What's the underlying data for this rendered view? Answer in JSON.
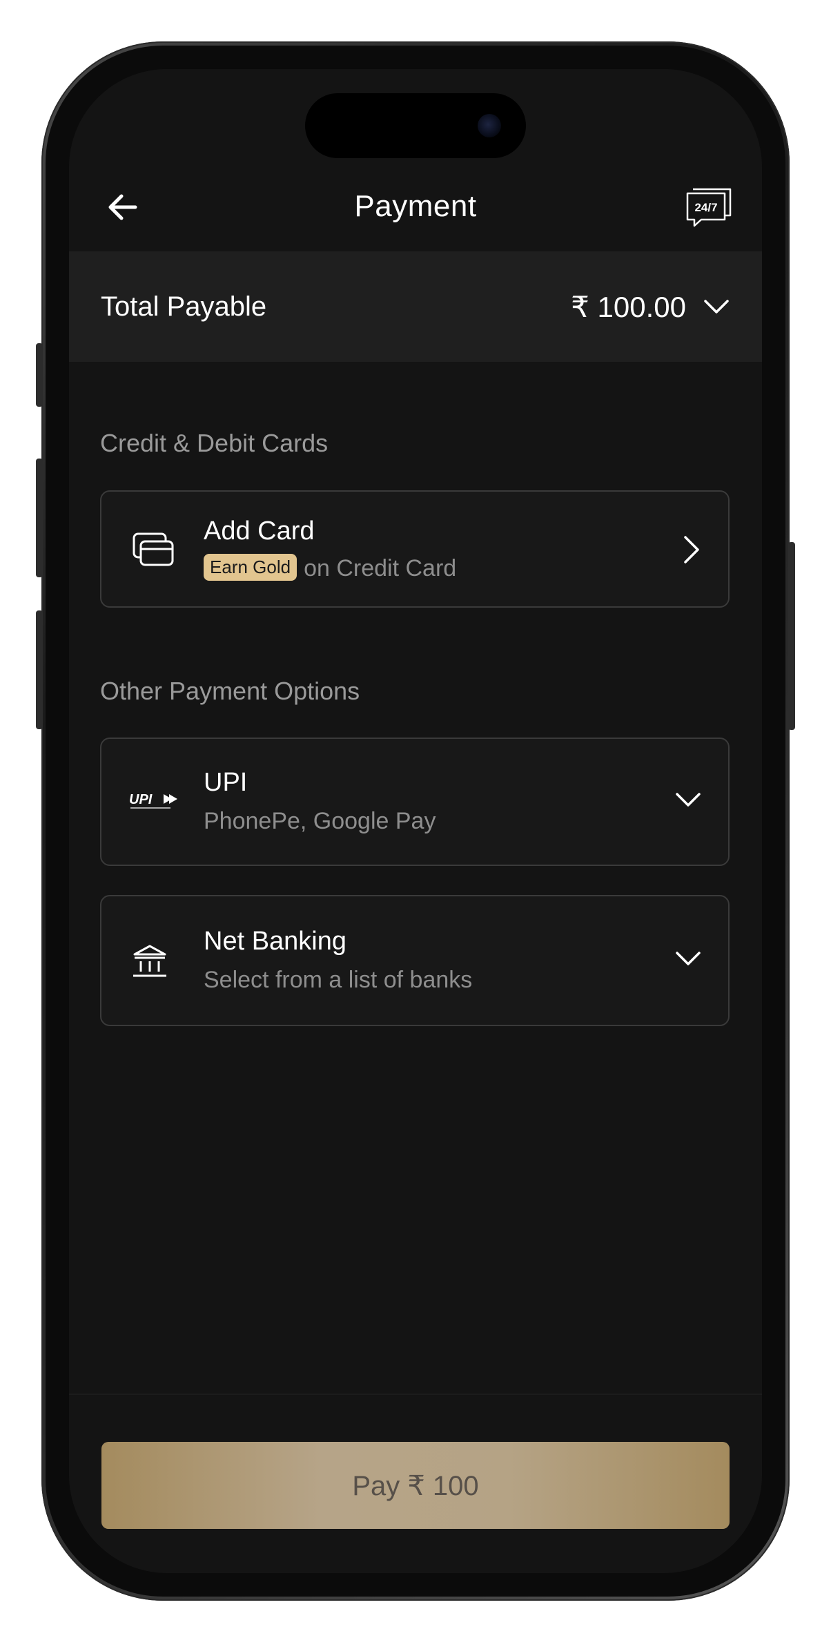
{
  "header": {
    "title": "Payment",
    "support_icon_text": "24/7"
  },
  "total": {
    "label": "Total Payable",
    "amount": "₹ 100.00"
  },
  "cards_section": {
    "title": "Credit & Debit Cards",
    "add_card": {
      "title": "Add Card",
      "badge": "Earn Gold",
      "subtitle": "on Credit Card"
    }
  },
  "other_section": {
    "title": "Other Payment Options",
    "upi": {
      "title": "UPI",
      "subtitle": "PhonePe, Google Pay"
    },
    "net_banking": {
      "title": "Net Banking",
      "subtitle": "Select from a list of banks"
    }
  },
  "pay_button": {
    "label": "Pay ₹ 100"
  },
  "icons": {
    "back": "arrow-left-icon",
    "support": "support-24-7-icon",
    "chevron_down": "chevron-down-icon",
    "chevron_right": "chevron-right-icon",
    "card": "credit-card-icon",
    "upi": "upi-logo-icon",
    "bank": "bank-icon"
  },
  "colors": {
    "background": "#141414",
    "panel": "#1f1f1f",
    "badge": "#e2c58f",
    "pay_button": "#a48b5e"
  }
}
